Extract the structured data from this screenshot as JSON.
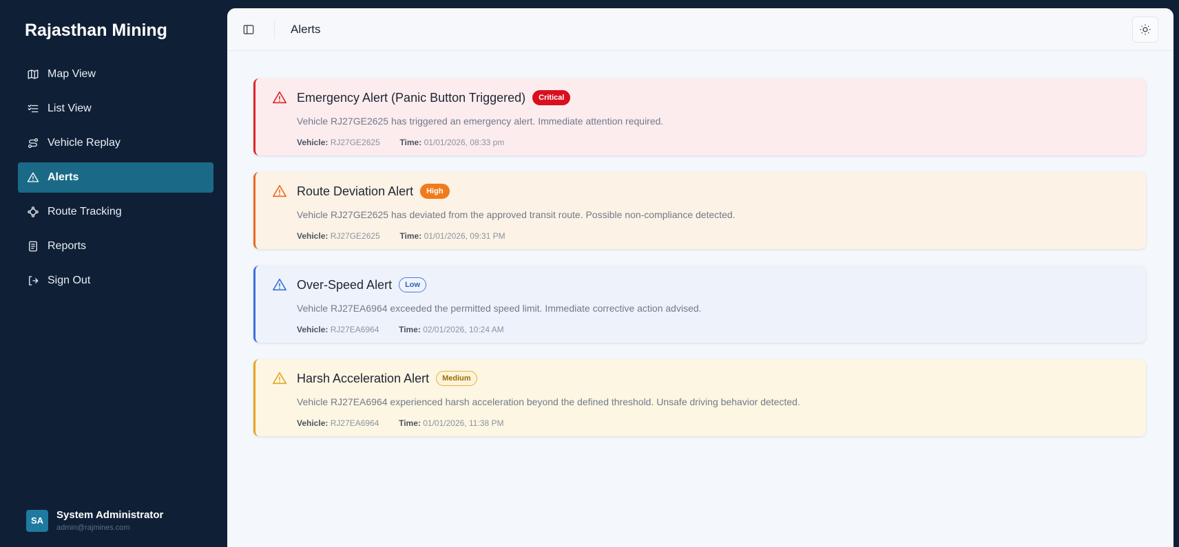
{
  "sidebar": {
    "brand": "Rajasthan Mining",
    "items": [
      {
        "label": "Map View",
        "icon": "map-icon"
      },
      {
        "label": "List View",
        "icon": "list-icon"
      },
      {
        "label": "Vehicle Replay",
        "icon": "route-replay-icon"
      },
      {
        "label": "Alerts",
        "icon": "alert-triangle-icon",
        "active": true
      },
      {
        "label": "Route Tracking",
        "icon": "waypoints-icon"
      },
      {
        "label": "Reports",
        "icon": "report-icon"
      },
      {
        "label": "Sign Out",
        "icon": "sign-out-icon"
      }
    ],
    "user": {
      "initials": "SA",
      "name": "System Administrator",
      "email": "admin@rajmines.com"
    }
  },
  "header": {
    "title": "Alerts",
    "panel_toggle_icon": "sidebar-toggle-icon",
    "theme_icon": "sun-icon"
  },
  "labels": {
    "vehicle": "Vehicle:",
    "time": "Time:"
  },
  "alerts": [
    {
      "title": "Emergency Alert (Panic Button Triggered)",
      "severity": "Critical",
      "description": "Vehicle RJ27GE2625 has triggered an emergency alert. Immediate attention required.",
      "vehicle": "RJ27GE2625",
      "time": "01/01/2026, 08:33 pm",
      "colors": {
        "accent": "#dc2626",
        "bg": "#fdecee",
        "badge_bg": "#d90f1f",
        "badge_fg": "#ffffff",
        "badge_border": "#d90f1f"
      }
    },
    {
      "title": "Route Deviation Alert",
      "severity": "High",
      "description": "Vehicle RJ27GE2625 has deviated from the approved transit route. Possible non-compliance detected.",
      "vehicle": "RJ27GE2625",
      "time": "01/01/2026, 09:31 PM",
      "colors": {
        "accent": "#ea6a1e",
        "bg": "#fdf2e6",
        "badge_bg": "#f07b1c",
        "badge_fg": "#ffffff",
        "badge_border": "#f07b1c"
      }
    },
    {
      "title": "Over-Speed Alert",
      "severity": "Low",
      "description": "Vehicle RJ27EA6964 exceeded the permitted speed limit. Immediate corrective action advised.",
      "vehicle": "RJ27EA6964",
      "time": "02/01/2026, 10:24 AM",
      "colors": {
        "accent": "#3b6fd8",
        "bg": "#eef3fb",
        "badge_bg": "#eef4ff",
        "badge_fg": "#2f5fb8",
        "badge_border": "#4a7bd6"
      }
    },
    {
      "title": "Harsh Acceleration Alert",
      "severity": "Medium",
      "description": "Vehicle RJ27EA6964 experienced harsh acceleration beyond the defined threshold. Unsafe driving behavior detected.",
      "vehicle": "RJ27EA6964",
      "time": "01/01/2026, 11:38 PM",
      "colors": {
        "accent": "#e3a61c",
        "bg": "#fdf6e3",
        "badge_bg": "#fdf3d8",
        "badge_fg": "#9a6d0a",
        "badge_border": "#e3b23c"
      }
    }
  ]
}
